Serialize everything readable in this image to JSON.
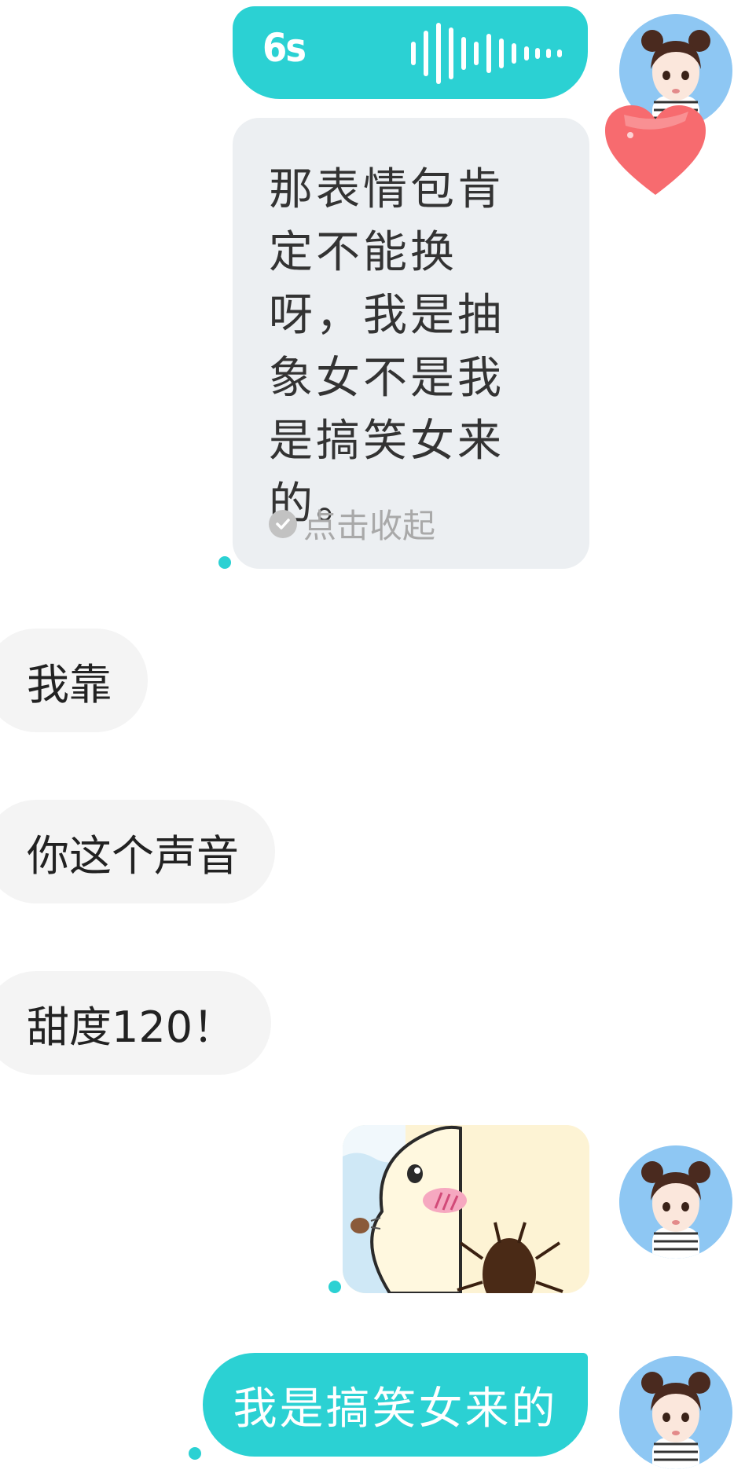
{
  "top_partial_text": "",
  "voice_message": {
    "duration": "6s"
  },
  "transcript": {
    "text": "那表情包肯定不能换呀，我是抽象女不是我是搞笑女来的。",
    "collapse_label": "点击收起"
  },
  "incoming_messages": [
    "我靠",
    "你这个声音",
    "甜度120！"
  ],
  "outgoing_text": "我是搞笑女来的",
  "colors": {
    "accent": "#2bd1d3",
    "incoming_bubble": "#f4f4f4",
    "transcript_bubble": "#eceff2",
    "avatar_bg": "#8ec7f3"
  }
}
